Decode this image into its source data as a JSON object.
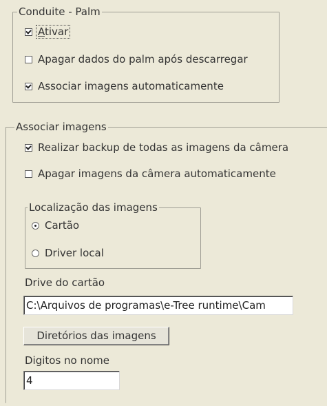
{
  "conduite_group": {
    "title": "Conduite - Palm",
    "ativar": {
      "label": "Ativar",
      "checked": true
    },
    "apagar_dados": {
      "label": "Apagar dados do palm após descarregar",
      "checked": false
    },
    "associar_auto": {
      "label": "Associar imagens automaticamente",
      "checked": true
    }
  },
  "associar_group": {
    "title": "Associar imagens",
    "backup": {
      "label": "Realizar backup de todas as imagens da câmera",
      "checked": true
    },
    "apagar_camera": {
      "label": "Apagar imagens da câmera automaticamente",
      "checked": false
    },
    "localizacao": {
      "title": "Localização das imagens",
      "cartao": {
        "label": "Cartão",
        "selected": true
      },
      "driver_local": {
        "label": "Driver local",
        "selected": false
      }
    },
    "drive_label": "Drive do cartão",
    "drive_value": "C:\\Arquivos de programas\\e-Tree runtime\\Cam",
    "diretorios_button": "Diretórios das imagens",
    "digitos_label": "Digitos no nome",
    "digitos_value": "4"
  },
  "colors": {
    "background": "#ece9d8",
    "group_border": "#9e9d93",
    "text": "#333333"
  }
}
